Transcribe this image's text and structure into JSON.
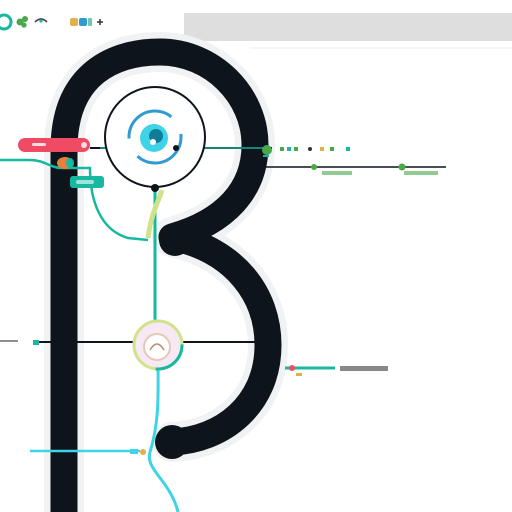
{
  "colors": {
    "background": "#ffffff",
    "top_bar": "#dedede",
    "glyph_stroke": "#0d141c",
    "teal": "#16b8a0",
    "cyan": "#3fd3e8",
    "lime": "#cfe48a",
    "red_pill": "#ef4b64",
    "green_dot": "#4aa84a",
    "grey_line": "#8a9096"
  },
  "icons": {
    "top_left": [
      "circle-icon",
      "leaf-icon",
      "bird-icon",
      "badge-icon",
      "plus-icon"
    ],
    "center_top_node": "swirl-icon",
    "center_mid_node": "rose-icon",
    "marker_small": "dot-icon"
  }
}
